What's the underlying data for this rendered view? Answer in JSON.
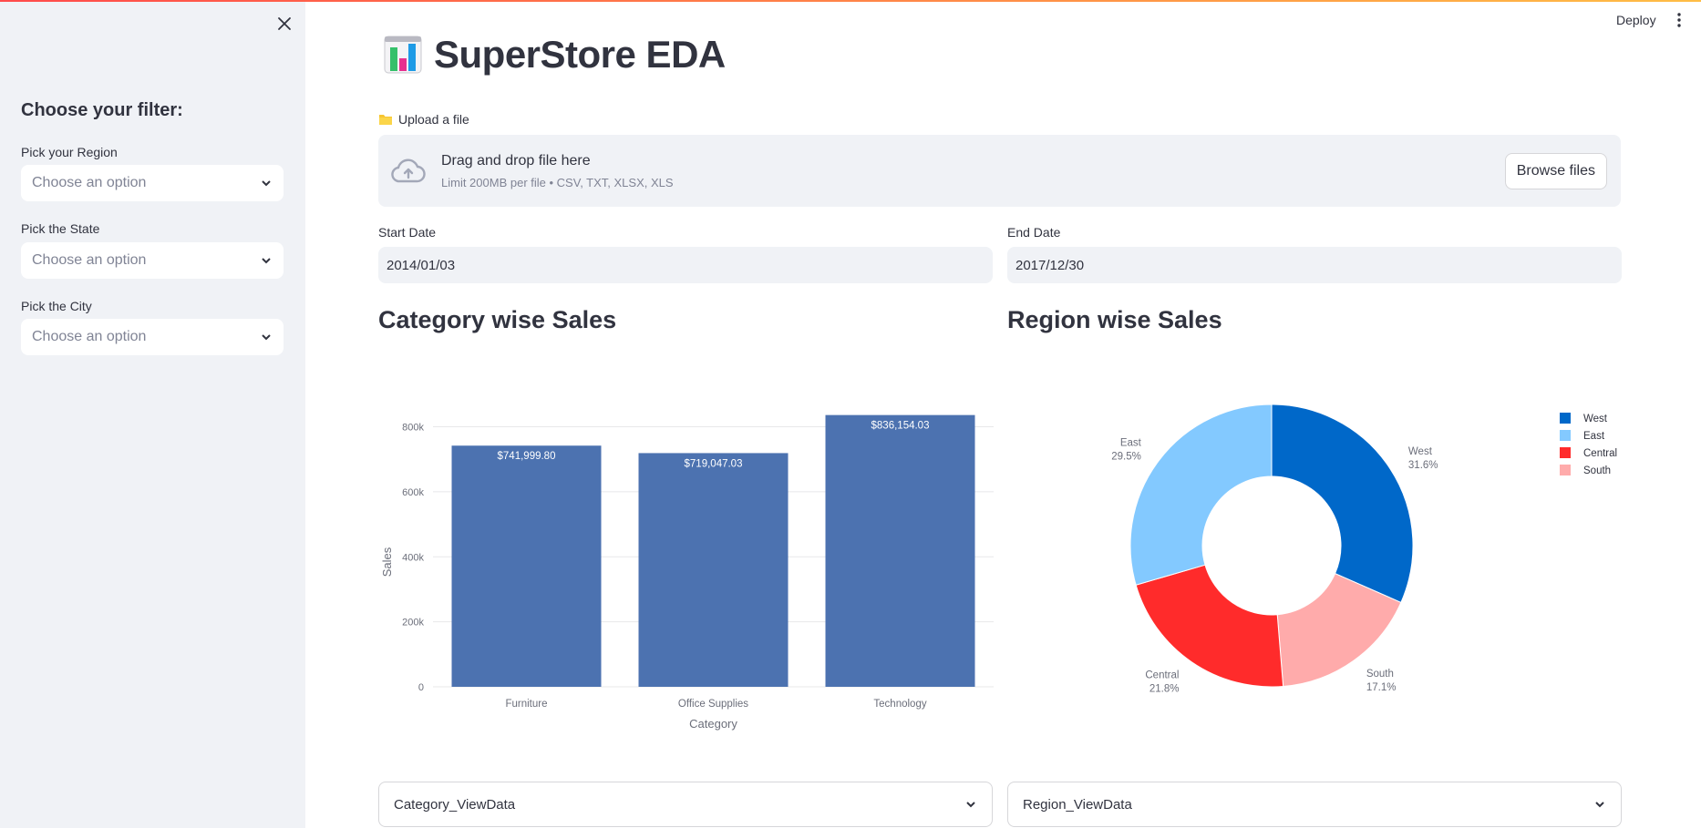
{
  "app": {
    "title": "SuperStore EDA",
    "deploy_label": "Deploy"
  },
  "sidebar": {
    "heading": "Choose your filter:",
    "filters": [
      {
        "label": "Pick your Region",
        "placeholder": "Choose an option"
      },
      {
        "label": "Pick the State",
        "placeholder": "Choose an option"
      },
      {
        "label": "Pick the City",
        "placeholder": "Choose an option"
      }
    ]
  },
  "upload": {
    "label": "Upload a file",
    "drag_text": "Drag and drop file here",
    "limit_text": "Limit 200MB per file • CSV, TXT, XLSX, XLS",
    "browse_label": "Browse files"
  },
  "dates": {
    "start_label": "Start Date",
    "start_value": "2014/01/03",
    "end_label": "End Date",
    "end_value": "2017/12/30"
  },
  "sections": {
    "category_title": "Category wise Sales",
    "region_title": "Region wise Sales"
  },
  "expanders": {
    "category": "Category_ViewData",
    "region": "Region_ViewData"
  },
  "colors": {
    "bar": "#4c72b0",
    "west": "#0068c9",
    "east": "#83c9ff",
    "central": "#ff2b2b",
    "south": "#ffabab",
    "accent": "#ff4b4b"
  },
  "chart_data": [
    {
      "type": "bar",
      "categories": [
        "Furniture",
        "Office Supplies",
        "Technology"
      ],
      "values": [
        741999.8,
        719047.03,
        836154.03
      ],
      "data_labels": [
        "$741,999.80",
        "$719,047.03",
        "$836,154.03"
      ],
      "xlabel": "Category",
      "ylabel": "Sales",
      "ylim": [
        0,
        880000
      ],
      "yticks": [
        0,
        200000,
        400000,
        600000,
        800000
      ],
      "ytick_labels": [
        "0",
        "200k",
        "400k",
        "600k",
        "800k"
      ],
      "grid": true
    },
    {
      "type": "pie",
      "hole": true,
      "slices": [
        {
          "label": "West",
          "percent": 31.6,
          "pct_label": "31.6%",
          "color": "#0068c9"
        },
        {
          "label": "South",
          "percent": 17.1,
          "pct_label": "17.1%",
          "color": "#ffabab"
        },
        {
          "label": "Central",
          "percent": 21.8,
          "pct_label": "21.8%",
          "color": "#ff2b2b"
        },
        {
          "label": "East",
          "percent": 29.5,
          "pct_label": "29.5%",
          "color": "#83c9ff"
        }
      ],
      "legend": [
        "West",
        "East",
        "Central",
        "South"
      ],
      "legend_placement": "top-right"
    }
  ]
}
